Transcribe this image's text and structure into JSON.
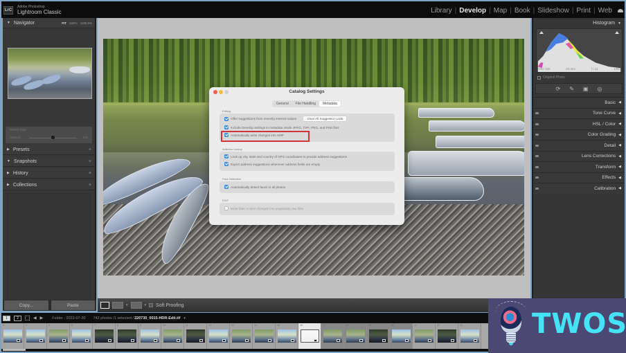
{
  "app": {
    "vendor": "Adobe Photoshop",
    "name": "Lightroom Classic",
    "badge": "LrC"
  },
  "modules": [
    {
      "label": "Library",
      "active": false
    },
    {
      "label": "Develop",
      "active": true
    },
    {
      "label": "Map",
      "active": false
    },
    {
      "label": "Book",
      "active": false
    },
    {
      "label": "Slideshow",
      "active": false
    },
    {
      "label": "Print",
      "active": false
    },
    {
      "label": "Web",
      "active": false
    }
  ],
  "left_panel": {
    "navigator": {
      "title": "Navigator",
      "zoom_options": [
        "FIT",
        "100%",
        "1195.5%"
      ]
    },
    "preset_tone": {
      "label": "Preset Tone",
      "amount_label": "Amount",
      "amount_value": "100",
      "amount_fraction": 0.5
    },
    "sections": [
      {
        "label": "Presets",
        "action": "+",
        "expanded": false
      },
      {
        "label": "Snapshots",
        "action": "+",
        "expanded": true
      },
      {
        "label": "History",
        "action": "×",
        "expanded": false
      },
      {
        "label": "Collections",
        "action": "+",
        "expanded": false
      }
    ],
    "copy_label": "Copy...",
    "paste_label": "Paste"
  },
  "dialog": {
    "title": "Catalog Settings",
    "tabs": [
      {
        "label": "General",
        "active": false
      },
      {
        "label": "File Handling",
        "active": false
      },
      {
        "label": "Metadata",
        "active": true
      }
    ],
    "groups": {
      "editing": {
        "label": "Editing",
        "options": [
          {
            "label": "Offer suggestions from recently entered values",
            "checked": true
          },
          {
            "label": "Include Develop settings in metadata inside JPEG, TIFF, PNG, and PSD files",
            "checked": true
          },
          {
            "label": "Automatically write changes into XMP",
            "checked": true,
            "highlighted": true
          }
        ],
        "clear_button": "Clear All Suggestion Lists"
      },
      "address_lookup": {
        "label": "Address Lookup",
        "options": [
          {
            "label": "Look up city, state and country of GPS coordinates to provide address suggestions",
            "checked": true
          },
          {
            "label": "Export address suggestions whenever address fields are empty",
            "checked": true
          }
        ]
      },
      "face_detection": {
        "label": "Face Detection",
        "options": [
          {
            "label": "Automatically detect faces in all photos",
            "checked": true
          }
        ]
      },
      "exif": {
        "label": "EXIF",
        "options": [
          {
            "label": "Write date or time changes into proprietary raw files.",
            "checked": false
          }
        ]
      }
    }
  },
  "toolbar": {
    "soft_proofing_label": "Soft Proofing"
  },
  "right_panel": {
    "histogram": {
      "title": "Histogram",
      "iso": "ISO 100",
      "focal_length": "24 mm",
      "aperture": "f / 11",
      "exposure": "1/80"
    },
    "original_photo_label": "Original Photo",
    "tools": [
      "crop-icon",
      "healing-icon",
      "masking-icon",
      "redeye-icon"
    ],
    "sections": [
      "Basic",
      "Tone Curve",
      "HSL / Color",
      "Color Grading",
      "Detail",
      "Lens Corrections",
      "Transform",
      "Effects",
      "Calibration"
    ]
  },
  "filmstrip": {
    "monitor_1": "1",
    "monitor_2": "2",
    "folder": "Folder : 2022-07-30",
    "count": "742 photos /1 selected /",
    "filename": "220730_0015-HDR-Edit.tif",
    "thumbs": [
      {
        "num": "3",
        "tone": "light"
      },
      {
        "num": "4",
        "tone": "light"
      },
      {
        "num": "5",
        "tone": "mid"
      },
      {
        "num": "6",
        "tone": "light"
      },
      {
        "num": "7",
        "tone": "dark"
      },
      {
        "num": "8",
        "tone": "dark"
      },
      {
        "num": "9",
        "tone": "light"
      },
      {
        "num": "10",
        "tone": "mid"
      },
      {
        "num": "11",
        "tone": "dark"
      },
      {
        "num": "12",
        "tone": "light"
      },
      {
        "num": "13",
        "tone": "mid"
      },
      {
        "num": "14",
        "tone": "mid"
      },
      {
        "num": "15",
        "tone": "light"
      },
      {
        "num": "16",
        "tone": "selected"
      },
      {
        "num": "17",
        "tone": "mid"
      },
      {
        "num": "18",
        "tone": "mid"
      },
      {
        "num": "19",
        "tone": "dark"
      },
      {
        "num": "20",
        "tone": "light"
      },
      {
        "num": "21",
        "tone": "mid"
      },
      {
        "num": "22",
        "tone": "dark"
      },
      {
        "num": "23",
        "tone": "light"
      }
    ]
  },
  "watermark": {
    "text": "TWOS"
  }
}
